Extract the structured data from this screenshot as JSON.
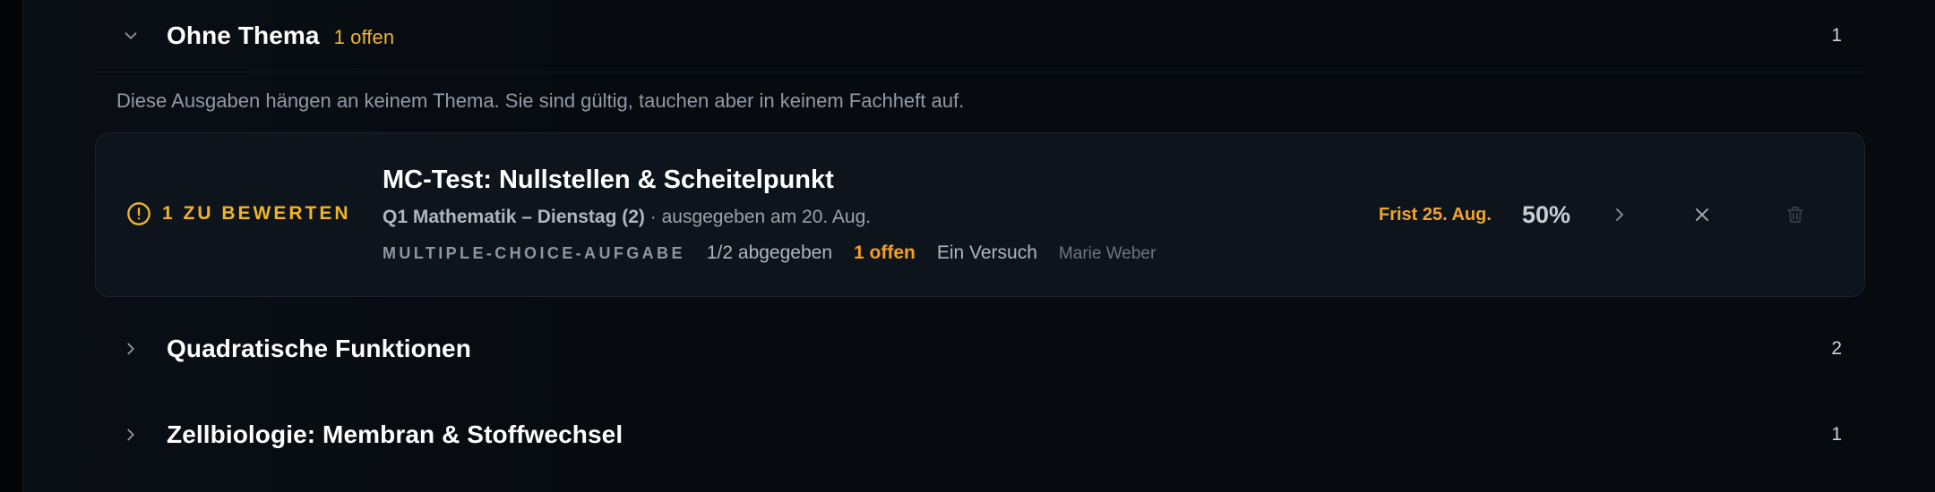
{
  "sections": [
    {
      "title": "Ohne Thema",
      "open_label": "1 offen",
      "count": "1",
      "expanded": true,
      "description": "Diese Ausgaben hängen an keinem Thema. Sie sind gültig, tauchen aber in keinem Fachheft auf."
    },
    {
      "title": "Quadratische Funktionen",
      "count": "2",
      "expanded": false
    },
    {
      "title": "Zellbiologie: Membran & Stoffwechsel",
      "count": "1",
      "expanded": false
    }
  ],
  "assignment": {
    "badge": "1 ZU BEWERTEN",
    "title": "MC-Test: Nullstellen & Scheitelpunkt",
    "course": "Q1 Mathematik – Dienstag (2)",
    "issued": " · ausgegeben am 20. Aug.",
    "type": "MULTIPLE-CHOICE-AUFGABE",
    "submitted": "1/2 abgegeben",
    "open": "1 offen",
    "attempts": "Ein Versuch",
    "teacher": "Marie Weber",
    "deadline": "Frist 25. Aug.",
    "score": "50%"
  },
  "icons": {
    "warning": "alert-circle-icon",
    "open": "chevron-right-icon",
    "close": "close-icon",
    "delete": "trash-icon"
  },
  "colors": {
    "accent": "#f0b429",
    "background": "#070b10",
    "card": "#0d141c"
  }
}
